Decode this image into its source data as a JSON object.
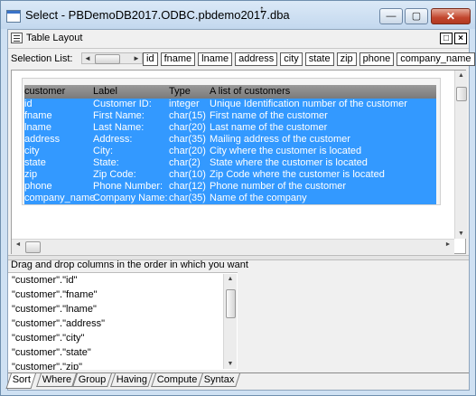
{
  "window": {
    "title": "Select - PBDemoDB2017.ODBC.pbdemo2017.dba",
    "controls": {
      "minimize": "—",
      "maximize": "▢",
      "close": "✕"
    }
  },
  "table_layout": {
    "title": "Table Layout",
    "selection_list_label": "Selection List:",
    "selection_columns": [
      "id",
      "fname",
      "lname",
      "address",
      "city",
      "state",
      "zip",
      "phone",
      "company_name"
    ],
    "header": {
      "customer": "customer",
      "label": "Label",
      "type": "Type",
      "description": "A list of customers"
    },
    "rows": [
      {
        "name": "id",
        "label": "Customer ID:",
        "type": "integer",
        "desc": "Unique Identification number of the customer"
      },
      {
        "name": "fname",
        "label": "First Name:",
        "type": "char(15)",
        "desc": "First name of the customer"
      },
      {
        "name": "lname",
        "label": "Last Name:",
        "type": "char(20)",
        "desc": "Last name of the customer"
      },
      {
        "name": "address",
        "label": "Address:",
        "type": "char(35)",
        "desc": "Mailing address of the customer"
      },
      {
        "name": "city",
        "label": "City:",
        "type": "char(20)",
        "desc": "City where the customer is located"
      },
      {
        "name": "state",
        "label": "State:",
        "type": "char(2)",
        "desc": "State where the customer is located"
      },
      {
        "name": "zip",
        "label": "Zip Code:",
        "type": "char(10)",
        "desc": "Zip Code where the customer is located"
      },
      {
        "name": "phone",
        "label": "Phone Number:",
        "type": "char(12)",
        "desc": "Phone number of the customer"
      },
      {
        "name": "company_name",
        "label": "Company Name:",
        "type": "char(35)",
        "desc": "Name of the company"
      }
    ],
    "selection_color": "#3399ff"
  },
  "sort_panel": {
    "instruction": "Drag and drop columns in the order in which you want",
    "items": [
      "\"customer\".\"id\"",
      "\"customer\".\"fname\"",
      "\"customer\".\"lname\"",
      "\"customer\".\"address\"",
      "\"customer\".\"city\"",
      "\"customer\".\"state\"",
      "\"customer\".\"zip\""
    ]
  },
  "tabs": [
    {
      "label": "Sort",
      "active": true
    },
    {
      "label": "Where",
      "active": false
    },
    {
      "label": "Group",
      "active": false
    },
    {
      "label": "Having",
      "active": false
    },
    {
      "label": "Compute",
      "active": false
    },
    {
      "label": "Syntax",
      "active": false
    }
  ]
}
